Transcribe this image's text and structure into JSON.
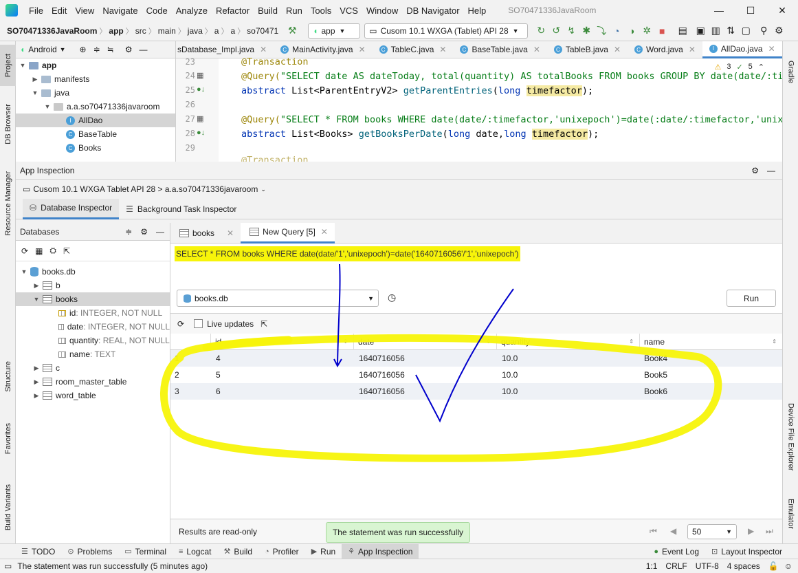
{
  "window": {
    "menu": [
      "File",
      "Edit",
      "View",
      "Navigate",
      "Code",
      "Analyze",
      "Refactor",
      "Build",
      "Run",
      "Tools",
      "VCS",
      "Window",
      "DB Navigator",
      "Help"
    ],
    "title": "SO70471336JavaRoom",
    "controls": [
      "—",
      "☐",
      "✕"
    ]
  },
  "navbar": {
    "crumbs": [
      "SO70471336JavaRoom",
      "app",
      "src",
      "main",
      "java",
      "a",
      "a",
      "so70471"
    ],
    "run_config": "app",
    "device": "Cusom 10.1  WXGA (Tablet) API 28"
  },
  "left_strip": [
    "Project",
    "DB Browser",
    "Resource Manager",
    "Structure",
    "Favorites",
    "Build Variants"
  ],
  "right_strip": [
    "Gradle",
    "Device File Explorer",
    "Emulator"
  ],
  "project": {
    "view": "Android",
    "tree": [
      {
        "label": "app",
        "bold": true
      },
      {
        "label": "manifests"
      },
      {
        "label": "java"
      },
      {
        "label": "a.a.so70471336javaroom"
      },
      {
        "label": "AllDao",
        "selected": true
      },
      {
        "label": "BaseTable"
      },
      {
        "label": "Books"
      }
    ]
  },
  "editor": {
    "tabs": [
      "sDatabase_Impl.java",
      "MainActivity.java",
      "TableC.java",
      "BaseTable.java",
      "TableB.java",
      "Word.java",
      "AllDao.java"
    ],
    "active_tab": "AllDao.java",
    "inspections": {
      "warnings": "3",
      "weak": "5"
    },
    "line_numbers": [
      "23",
      "24",
      "25",
      "26",
      "27",
      "28",
      "29"
    ],
    "lines": {
      "l23": "@Transaction",
      "l24_anno": "@Query(",
      "l24_str": "\"SELECT date AS dateToday, total(quantity) AS totalBooks FROM books GROUP BY date(date/:tim",
      "l25_kw": "abstract",
      "l25_type": " List<ParentEntryV2> ",
      "l25_fn": "getParentEntries",
      "l25_args_a": "(",
      "l25_kw2": "long",
      "l25_hl": "timefactor",
      "l25_end": ");",
      "l27_anno": "@Query(",
      "l27_str": "\"SELECT * FROM books WHERE date(date/:timefactor,'unixepoch')=date(:date/:timefactor,'unixep",
      "l28_kw": "abstract",
      "l28_type": " List<Books> ",
      "l28_fn": "getBooksPerDate",
      "l28_a": "(",
      "l28_kw2": "long",
      "l28_b": " date,",
      "l28_kw3": "long",
      "l28_sp": " ",
      "l28_hl": "timefactor",
      "l28_end": ");",
      "l30": "@Transaction"
    }
  },
  "app_inspection": {
    "title": "App Inspection",
    "device_process": "Cusom 10.1 WXGA Tablet API 28 > a.a.so70471336javaroom",
    "tabs": [
      "Database Inspector",
      "Background Task Inspector"
    ],
    "databases_title": "Databases",
    "db_tree": {
      "db": "books.db",
      "b": "b",
      "books": "books",
      "columns": [
        {
          "name": "id",
          "type": " : INTEGER, NOT NULL"
        },
        {
          "name": "date",
          "type": " : INTEGER, NOT NULL"
        },
        {
          "name": "quantity",
          "type": " : REAL, NOT NULL"
        },
        {
          "name": "name",
          "type": " : TEXT"
        }
      ],
      "c": "c",
      "room_master_table": "room_master_table",
      "word_table": "word_table"
    },
    "query_tabs": [
      "books",
      "New Query [5]"
    ],
    "query_text": "SELECT * FROM books WHERE date(date/'1','unixepoch')=date('1640716056'/'1','unixepoch')",
    "db_select": "books.db",
    "run_label": "Run",
    "live_updates": "Live updates",
    "columns": [
      "id",
      "date",
      "quantity",
      "name"
    ],
    "rows": [
      {
        "n": "1",
        "id": "4",
        "date": "1640716056",
        "quantity": "10.0",
        "name": "Book4"
      },
      {
        "n": "2",
        "id": "5",
        "date": "1640716056",
        "quantity": "10.0",
        "name": "Book5"
      },
      {
        "n": "3",
        "id": "6",
        "date": "1640716056",
        "quantity": "10.0",
        "name": "Book6"
      }
    ],
    "readonly_note": "Results are read-only",
    "page_size": "50"
  },
  "toast": "The statement was run successfully",
  "tool_windows": [
    "TODO",
    "Problems",
    "Terminal",
    "Logcat",
    "Build",
    "Profiler",
    "Run",
    "App Inspection"
  ],
  "tool_windows_right": [
    "Event Log",
    "Layout Inspector"
  ],
  "status": {
    "message": "The statement was run successfully (5 minutes ago)",
    "position": "1:1",
    "line_sep": "CRLF",
    "encoding": "UTF-8",
    "indent": "4 spaces"
  },
  "colors": {
    "accent": "#4083c9",
    "highlighter": "#f7f40a",
    "pen": "#0000cc",
    "toast_bg": "#d9f5d2"
  }
}
